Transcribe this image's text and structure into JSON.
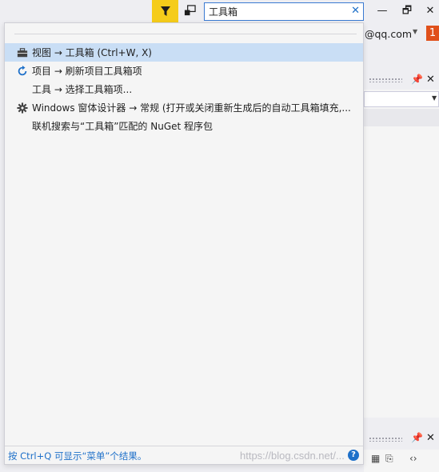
{
  "toolbar": {
    "filter_icon": "filter-icon",
    "feedback_icon": "feedback-icon"
  },
  "search": {
    "value": "工具箱",
    "clear_icon": "close-icon",
    "accent_color": "#3a7ad2"
  },
  "window_controls": {
    "minimize": "—",
    "restore": "🗗",
    "close": "✕"
  },
  "account": {
    "email_fragment": "@qq.com",
    "notification_count": "1"
  },
  "popup": {
    "results": [
      {
        "text": "视图 → 工具箱 (Ctrl+W, X)",
        "icon": "toolbox-icon",
        "selected": true
      },
      {
        "text": "项目 → 刷新项目工具箱项",
        "icon": "refresh-icon",
        "selected": false
      },
      {
        "text": "工具 → 选择工具箱项...",
        "icon": "",
        "selected": false
      },
      {
        "text": "Windows 窗体设计器 → 常规 (打开或关闭重新生成后的自动工具箱填充,...",
        "icon": "gear-icon",
        "selected": false
      },
      {
        "text": "联机搜索与“工具箱”匹配的 NuGet 程序包",
        "icon": "",
        "selected": false
      }
    ],
    "footer": "按 Ctrl+Q 可显示“菜单”个结果。",
    "selected_color": "#c9def5"
  },
  "watermark": "https://blog.csdn.net/..."
}
